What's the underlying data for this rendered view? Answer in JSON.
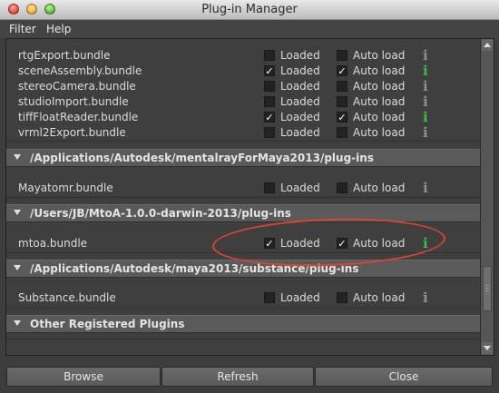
{
  "window": {
    "title": "Plug-in Manager"
  },
  "menu": {
    "filter": "Filter",
    "help": "Help"
  },
  "labels": {
    "loaded": "Loaded",
    "auto_load": "Auto load",
    "info": "i"
  },
  "groups": [
    {
      "path": "",
      "plugins": [
        {
          "name": "rtgExport.bundle",
          "loaded": false,
          "auto_load": false
        },
        {
          "name": "sceneAssembly.bundle",
          "loaded": true,
          "auto_load": true
        },
        {
          "name": "stereoCamera.bundle",
          "loaded": false,
          "auto_load": false
        },
        {
          "name": "studioImport.bundle",
          "loaded": false,
          "auto_load": false
        },
        {
          "name": "tiffFloatReader.bundle",
          "loaded": true,
          "auto_load": true
        },
        {
          "name": "vrml2Export.bundle",
          "loaded": false,
          "auto_load": false
        }
      ]
    },
    {
      "path": "/Applications/Autodesk/mentalrayForMaya2013/plug-ins",
      "plugins": [
        {
          "name": "Mayatomr.bundle",
          "loaded": false,
          "auto_load": false
        }
      ]
    },
    {
      "path": "/Users/JB/MtoA-1.0.0-darwin-2013/plug-ins",
      "plugins": [
        {
          "name": "mtoa.bundle",
          "loaded": true,
          "auto_load": true
        }
      ]
    },
    {
      "path": "/Applications/Autodesk/maya2013/substance/plug-ins",
      "plugins": [
        {
          "name": "Substance.bundle",
          "loaded": false,
          "auto_load": false
        }
      ]
    },
    {
      "path": "Other Registered Plugins",
      "plugins": []
    }
  ],
  "buttons": {
    "browse": "Browse",
    "refresh": "Refresh",
    "close": "Close"
  },
  "colors": {
    "annotation": "#d9452f",
    "info_loaded": "#3bc03b"
  }
}
